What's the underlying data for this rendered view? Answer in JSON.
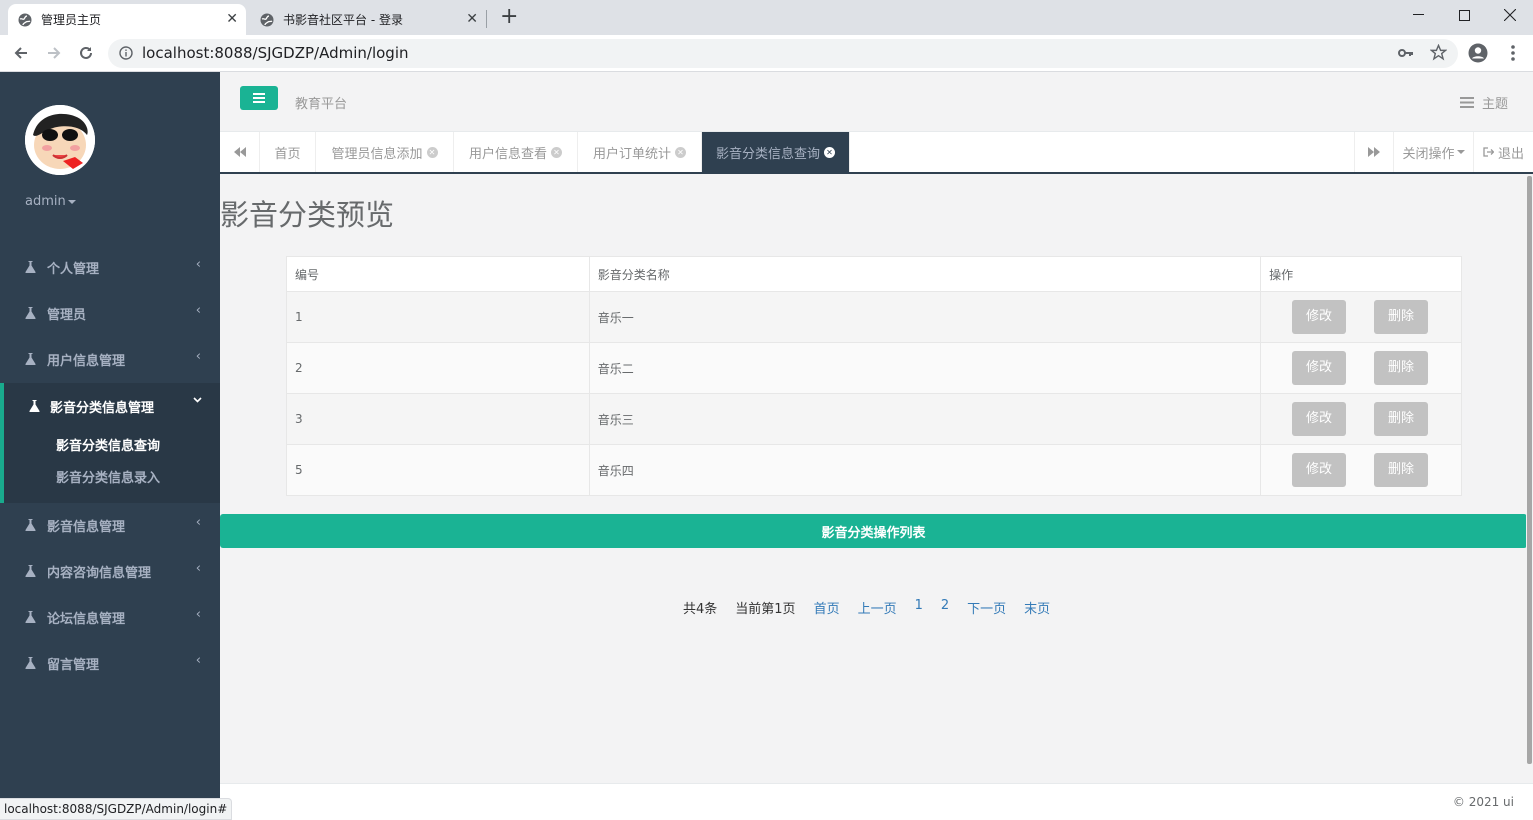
{
  "browser": {
    "tabs": [
      {
        "title": "管理员主页",
        "active": true
      },
      {
        "title": "书影音社区平台 - 登录",
        "active": false
      }
    ],
    "url": "localhost:8088/SJGDZP/Admin/login",
    "status_url": "localhost:8088/SJGDZP/Admin/login#"
  },
  "sidebar": {
    "user_name": "admin",
    "menu": [
      {
        "label": "个人管理"
      },
      {
        "label": "管理员"
      },
      {
        "label": "用户信息管理"
      },
      {
        "label": "影音分类信息管理",
        "expanded": true,
        "children": [
          {
            "label": "影音分类信息查询",
            "active": true
          },
          {
            "label": "影音分类信息录入"
          }
        ]
      },
      {
        "label": "影音信息管理"
      },
      {
        "label": "内容咨询信息管理"
      },
      {
        "label": "论坛信息管理"
      },
      {
        "label": "留言管理"
      }
    ]
  },
  "header": {
    "brand": "教育平台",
    "theme_label": "主题"
  },
  "page_tabs": {
    "tabs": [
      {
        "label": "首页"
      },
      {
        "label": "管理员信息添加"
      },
      {
        "label": "用户信息查看"
      },
      {
        "label": "用户订单统计"
      },
      {
        "label": "影音分类信息查询",
        "active": true
      }
    ],
    "close_ops": "关闭操作",
    "logout": "退出"
  },
  "main": {
    "title": "影音分类预览",
    "table": {
      "columns": [
        "编号",
        "影音分类名称",
        "操作"
      ],
      "rows": [
        {
          "id": "1",
          "name": "音乐一"
        },
        {
          "id": "2",
          "name": "音乐二"
        },
        {
          "id": "3",
          "name": "音乐三"
        },
        {
          "id": "5",
          "name": "音乐四"
        }
      ],
      "edit_label": "修改",
      "delete_label": "删除"
    },
    "action_bar": "影音分类操作列表",
    "pager": {
      "total": "共4条",
      "current": "当前第1页",
      "first": "首页",
      "prev": "上一页",
      "page1": "1",
      "page2": "2",
      "next": "下一页",
      "last": "末页"
    }
  },
  "footer": {
    "copyright": "© 2021 ui"
  },
  "colors": {
    "accent": "#1ab394",
    "sidebar": "#2f4050",
    "sidebar_active": "#293846"
  }
}
